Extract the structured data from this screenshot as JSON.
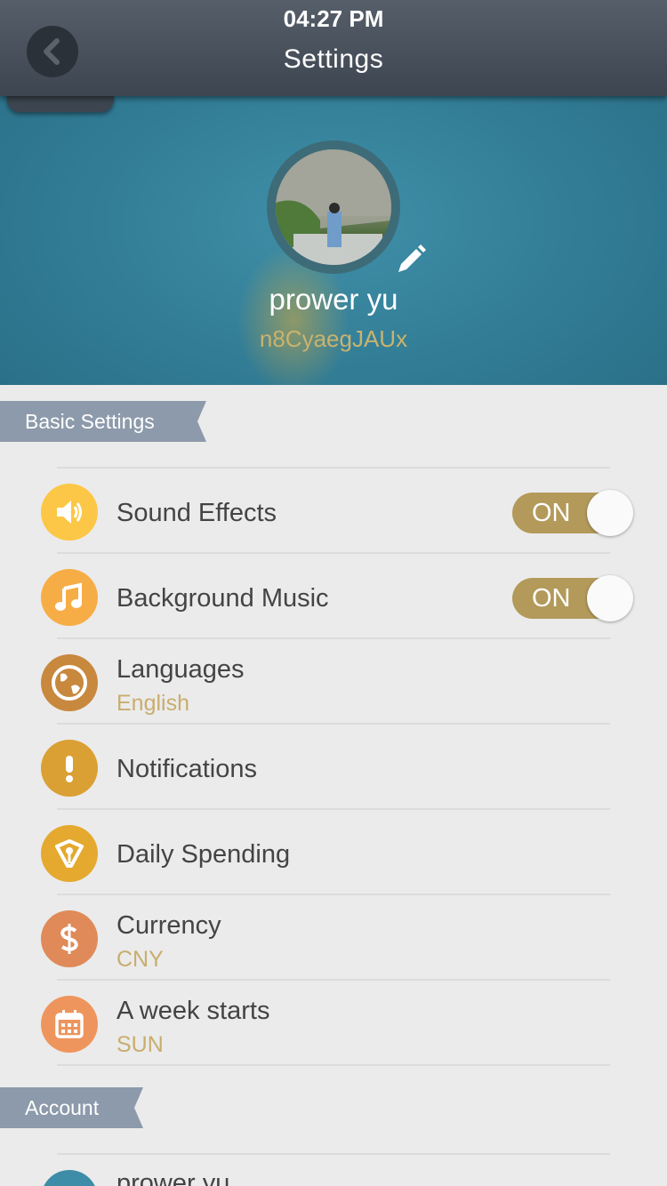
{
  "status": {
    "time": "04:27 PM"
  },
  "header": {
    "title": "Settings"
  },
  "profile": {
    "name": "prower yu",
    "id": "n8CyaegJAUx"
  },
  "sections": {
    "basic": "Basic Settings",
    "account": "Account"
  },
  "settings": [
    {
      "label": "Sound Effects",
      "icon": "speaker-icon",
      "color": "#fcc746",
      "toggle": "ON"
    },
    {
      "label": "Background Music",
      "icon": "music-note-icon",
      "color": "#f7ad45",
      "toggle": "ON"
    },
    {
      "label": "Languages",
      "sub": "English",
      "icon": "globe-icon",
      "color": "#c8883e"
    },
    {
      "label": "Notifications",
      "icon": "exclamation-icon",
      "color": "#daa033"
    },
    {
      "label": "Daily Spending",
      "icon": "pen-nib-icon",
      "color": "#e4a92e"
    },
    {
      "label": "Currency",
      "sub": "CNY",
      "icon": "dollar-icon",
      "color": "#df8a58"
    },
    {
      "label": "A week starts",
      "sub": "SUN",
      "icon": "calendar-icon",
      "color": "#ee955d"
    }
  ],
  "account": [
    {
      "label": "prower yu",
      "icon": "user-icon",
      "color": "#3d8ca8"
    }
  ]
}
